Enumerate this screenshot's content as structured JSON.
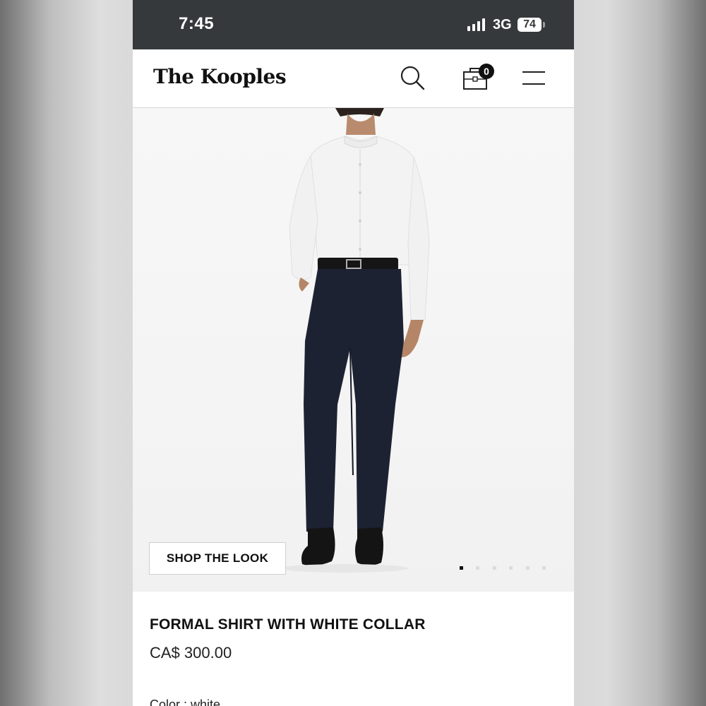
{
  "status_bar": {
    "time": "7:45",
    "network": "3G",
    "battery": "74",
    "signal_icon": "signal-bars-icon"
  },
  "header": {
    "brand": "The Kooples",
    "search_icon": "search-icon",
    "bag_icon": "shopping-bag-icon",
    "bag_count": "0",
    "menu_icon": "hamburger-menu-icon"
  },
  "gallery": {
    "shop_the_look_label": "SHOP THE LOOK",
    "slide_count": 6,
    "active_slide": 1
  },
  "product": {
    "title": "FORMAL SHIRT WITH WHITE COLLAR",
    "price": "CA$ 300.00",
    "color_label": "Color : white"
  },
  "colors": {
    "status_bar_bg": "#35393b",
    "text": "#111111"
  }
}
